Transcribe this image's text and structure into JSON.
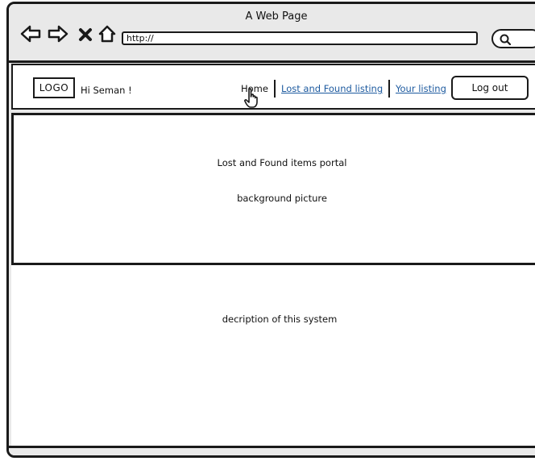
{
  "window": {
    "title": "A Web Page"
  },
  "browser": {
    "url": "http://",
    "icons": [
      "back-arrow-icon",
      "forward-arrow-icon",
      "stop-icon",
      "home-icon",
      "search-icon"
    ]
  },
  "header": {
    "logo": "LOGO",
    "greeting": "Hi Seman !",
    "nav": {
      "home": "Home",
      "lost_found": "Lost and Found listing",
      "your_listing": "Your listing"
    },
    "logout": "Log out"
  },
  "hero": {
    "title": "Lost and Found items portal",
    "background_note": "background picture"
  },
  "content": {
    "description": "decription of this system"
  },
  "colors": {
    "link": "#1d5a9f",
    "chrome": "#e9e9e9",
    "border": "#1a1a1a"
  }
}
